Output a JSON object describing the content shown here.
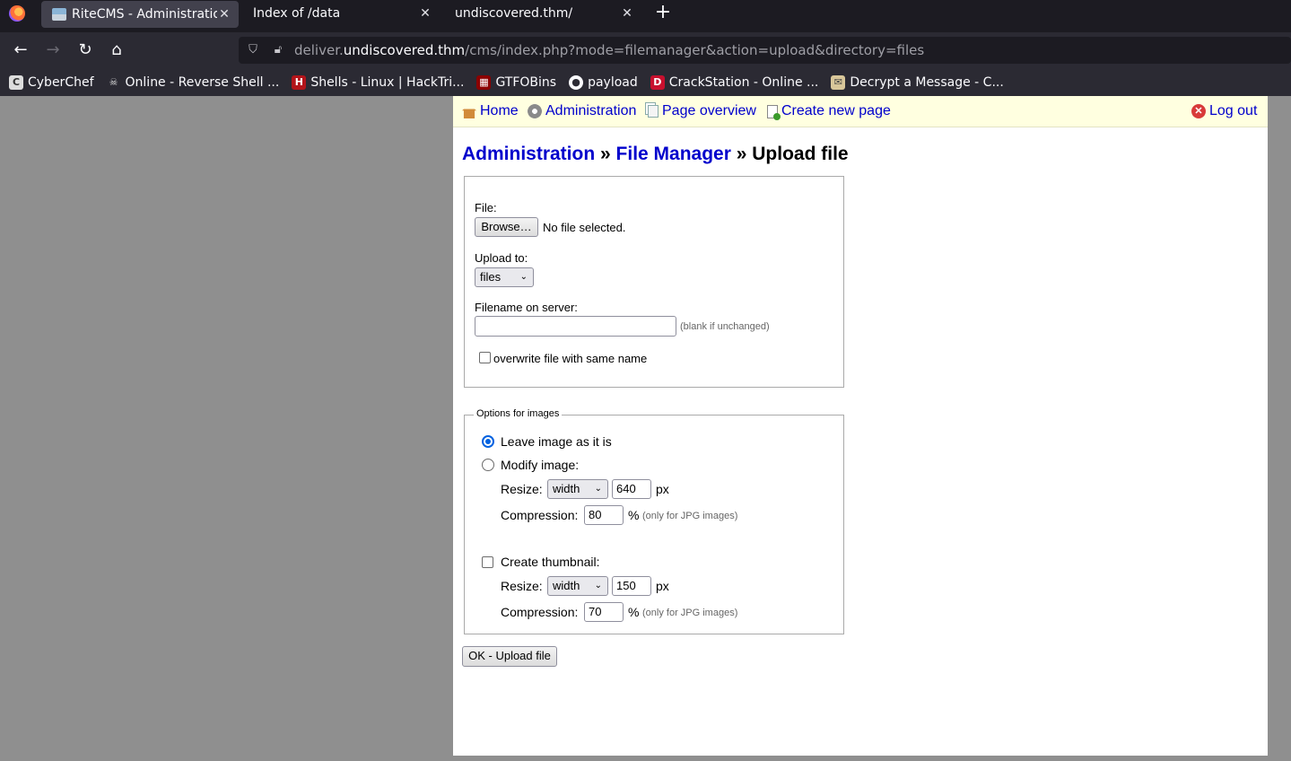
{
  "browser": {
    "tabs": [
      {
        "title": "RiteCMS - Administration",
        "active": true
      },
      {
        "title": "Index of /data",
        "active": false
      },
      {
        "title": "undiscovered.thm/",
        "active": false
      }
    ],
    "url": {
      "prefix": "deliver.",
      "host": "undiscovered.thm",
      "path": "/cms/index.php?mode=filemanager&action=upload&directory=files"
    },
    "bookmarks": [
      {
        "label": "CyberChef",
        "icon": "chef-icon"
      },
      {
        "label": "Online - Reverse Shell ...",
        "icon": "skull-icon"
      },
      {
        "label": "Shells - Linux | HackTri...",
        "icon": "hacktricks-icon"
      },
      {
        "label": "GTFOBins",
        "icon": "gtfobins-icon"
      },
      {
        "label": "payload",
        "icon": "github-icon"
      },
      {
        "label": "CrackStation - Online ...",
        "icon": "crackstation-icon"
      },
      {
        "label": "Decrypt a Message - C...",
        "icon": "decrypt-icon"
      }
    ]
  },
  "cms": {
    "nav": {
      "home": "Home",
      "administration": "Administration",
      "page_overview": "Page overview",
      "create_new_page": "Create new page",
      "logout": "Log out"
    },
    "breadcrumb": {
      "admin": "Administration",
      "sep1": " » ",
      "file_manager": "File Manager",
      "sep2": " » ",
      "current": "Upload file"
    },
    "upload": {
      "file_label": "File:",
      "browse_button": "Browse…",
      "no_file": "No file selected.",
      "upload_to_label": "Upload to:",
      "upload_to_value": "files",
      "filename_label": "Filename on server:",
      "filename_value": "",
      "filename_hint": "(blank if unchanged)",
      "overwrite_label": "overwrite file with same name",
      "overwrite_checked": false
    },
    "image_options": {
      "legend": "Options for images",
      "leave_label": "Leave image as it is",
      "modify_label": "Modify image:",
      "resize_label": "Resize:",
      "resize_mode": "width",
      "resize_value": "640",
      "px": "px",
      "compression_label": "Compression:",
      "compression_value": "80",
      "percent": "%",
      "jpg_hint": "(only for JPG images)",
      "thumbnail_label": "Create thumbnail:",
      "thumb_resize_label": "Resize:",
      "thumb_resize_mode": "width",
      "thumb_resize_value": "150",
      "thumb_px": "px",
      "thumb_compression_label": "Compression:",
      "thumb_compression_value": "70",
      "thumb_percent": "%",
      "thumb_jpg_hint": "(only for JPG images)"
    },
    "submit_button": "OK - Upload file"
  }
}
